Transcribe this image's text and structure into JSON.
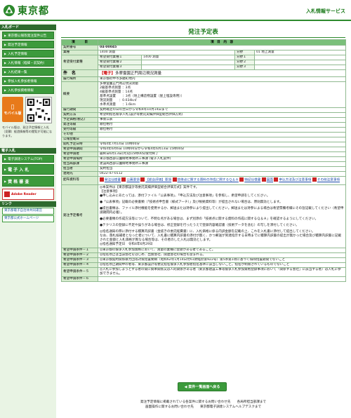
{
  "header": {
    "logo": "東京都",
    "site_title": "入札情報サービス"
  },
  "sidebar": {
    "menu_head": "入札ボード",
    "items": [
      "東京都公報等発注案件公告",
      "発注予定情報",
      "入札予定情報",
      "入札情報（経緯・前契約）",
      "入札結果一覧",
      "参加入札参加者情報",
      "入札参加資格情報"
    ],
    "mobile_button": "モバイル版",
    "mobile_note": "モバイル版は、発注予定情報と入札（見積）経過情報等の閲覧が可能になります。",
    "link_head": "電子入札",
    "big_items": [
      "電子調達システム(TOP)",
      "電 子 入 札",
      "資 格 審 査"
    ],
    "adobe": "Adobe Reader",
    "links_head": "リンク",
    "links": [
      "東京都電子自治体共同運営",
      "東京都公式ホームページ"
    ]
  },
  "page": {
    "title": "発注予定表",
    "col_item": "項　　　目",
    "col_content": "項　目　内　容"
  },
  "rows": {
    "contract_no": {
      "label": "契約番号",
      "value": "04-00045"
    },
    "business": {
      "label": "業種",
      "value": "1400 測量",
      "sub_label": "分野",
      "sub_value": "01 地上測量"
    },
    "hope": {
      "label": "希望受付業種",
      "items": [
        {
          "label": "希望受付業種１",
          "value": "1400 測量",
          "sub_label": "分野１",
          "sub_value": ""
        },
        {
          "label": "希望受付業種２",
          "value": "",
          "sub_label": "分野２",
          "sub_value": ""
        },
        {
          "label": "希望受付業種３",
          "value": "",
          "sub_label": "分野３",
          "sub_value": ""
        }
      ]
    },
    "subject": {
      "label": "件　名",
      "tag": "【電子】",
      "value": "多摩霊園正門周辺現況測量"
    },
    "place": {
      "label": "履行場所",
      "value": "東京都府中市多磨町地内"
    },
    "summary": {
      "label": "概要",
      "lines": [
        "多摩霊園正門周辺現況測量",
        "2級基準点測量 ：3点",
        "4級基準点測量 ：14点",
        "基準点設置　　：3点（地上構造物設置（屋上埋設専用））",
        "現況測量　　：0.034k㎡",
        "水準点測量　　：1.6km"
      ]
    },
    "period": {
      "label": "履行期間",
      "value": "契約確定の日の翌日から令和4年10月14日まで"
    },
    "method": {
      "label": "契約方法",
      "value": "希望制指名競争入札(設計等委託実績評価型総合評価方式)"
    },
    "price": {
      "label": "予定価格(税込)",
      "value": "事後公表"
    },
    "order_type": {
      "label": "発注等級",
      "value": "順位格付"
    },
    "accept_type": {
      "label": "受付等級",
      "value": "順位格付"
    },
    "other": {
      "label": "その他",
      "value": ""
    },
    "publish_date": {
      "label": "公報登載日",
      "value": ""
    },
    "open_date": {
      "label": "開札予定日時",
      "value": "令和4年7月14日 10時00分"
    },
    "apply_period": {
      "label": "希望申請期間",
      "value": "令和4年6月6日 10時00分から令和4年6月13日 15時00分"
    },
    "apply_date": {
      "label": "希望申請者",
      "value": "最終日6月13日(月)は15時00分受付終了"
    },
    "dept": {
      "label": "希望申請場所",
      "value": "東京都西部公園緑地事務所工事課 (電子入札案件)"
    },
    "section": {
      "label": "担当局部課",
      "value": "建設局西部公園緑地事務所工事課"
    },
    "person": {
      "label": "担当者",
      "value": "契約担当"
    },
    "tel": {
      "label": "連絡先",
      "value": "0422-47-0112"
    },
    "docs": {
      "label": "配布資料等",
      "links": [
        "発注仕様書",
        "公募要領",
        "【総合評価】要領",
        "技術点に関する資料の作成に関するＱ＆Ａ",
        "特記仕様書",
        "図面",
        "申込方法及び注意事項",
        "その他注意事項"
      ]
    },
    "notes": {
      "label": "発注予定備考",
      "lines": [
        "◎本案件は【東京都設計等委託実績評価型総合評価方式】案件です。",
        "【注意事項】",
        "●申し込みにあたっては、添付ファイル「公表事項」、「申込方法及び注意事項」を参照し、希望申請をしてください。",
        "●「公表事項」記載の必要書類（「技術点申告書（様式アーチ）」及び根拠資料等）が提出されない場合は、原則無効とします。",
        "●提出書類は、ファイル添付機能を使用するか、郵送または持参により提出してください。郵送または持参による場合は希望票備考欄にその旨記載してください（希望申請期間内必着）。",
        "●必要書類の作成方法等について、不明な点がある場合は、まず別添の「技術点に関する資料の作成に関するＱ＆Ａ」を確認するようにしてください。",
        "●テクリスの登録に不足や誤りがある場合は、修正登録を行ったうえで登録内容確認書（技術データを含む）の写しを添付してください。",
        "◎指名通知の際に添付する積算内訳書（金抜きの委託経費書）に、入札価格に係る内訳金額を記載の上、これを入札書に添付して提出してください。",
        "なお、落札候補者となった者について、入札書に積算内訳書の添付が無く、かつ郵送が到達指示する日時までに積算内訳書の提出が無かった場合及び積算内訳書に記載された金額と入札価格が異なる場合等は、その者のした入札は無効とします。",
        "◎指名通知予定日　令和4年6月29日"
      ]
    },
    "conditions": [
      {
        "label": "希望申請条件－１",
        "value": "◎東京都の競争入札参加資格において、測量の業種に登録がある者であること。"
      },
      {
        "label": "希望申請条件－２",
        "value": "◎指名停止は当該会社をはじめ、出資会社、関連会社の場合も含まれる。"
      },
      {
        "label": "希望申請条件－３",
        "value": "◎東京都契約関係暴力団等対策措置要綱（昭和62年1月14日付61財経庶第922号）第5条第1項に基づく排除措置期間でないこと"
      },
      {
        "label": "希望申請条件－４",
        "value": "◎指名停止期間中の者等、東京都設計等委託指名競争入札参加者指名基準に該当しないこと。指名が制限されているものでないこと"
      },
      {
        "label": "希望申請条件－５",
        "value": "◎入札に参加しようとする者の間に資本関係又は人的関係がある者（東京都建設工事等競争入札参加資格登録事項において「関係する会社」に該当する者）は入札に参加できません。"
      },
      {
        "label": "希望申請条件－６",
        "value": ""
      }
    ]
  },
  "back_button": "案件一覧画面へ戻る",
  "footer": {
    "line1": "発注予定情報に掲載されている各案件に関するお問い合わせ先　　各局所担当部課まで",
    "line2": "画面操作に関するお問い合わせ先　　東京都電子調達システムヘルプデスクまで"
  }
}
